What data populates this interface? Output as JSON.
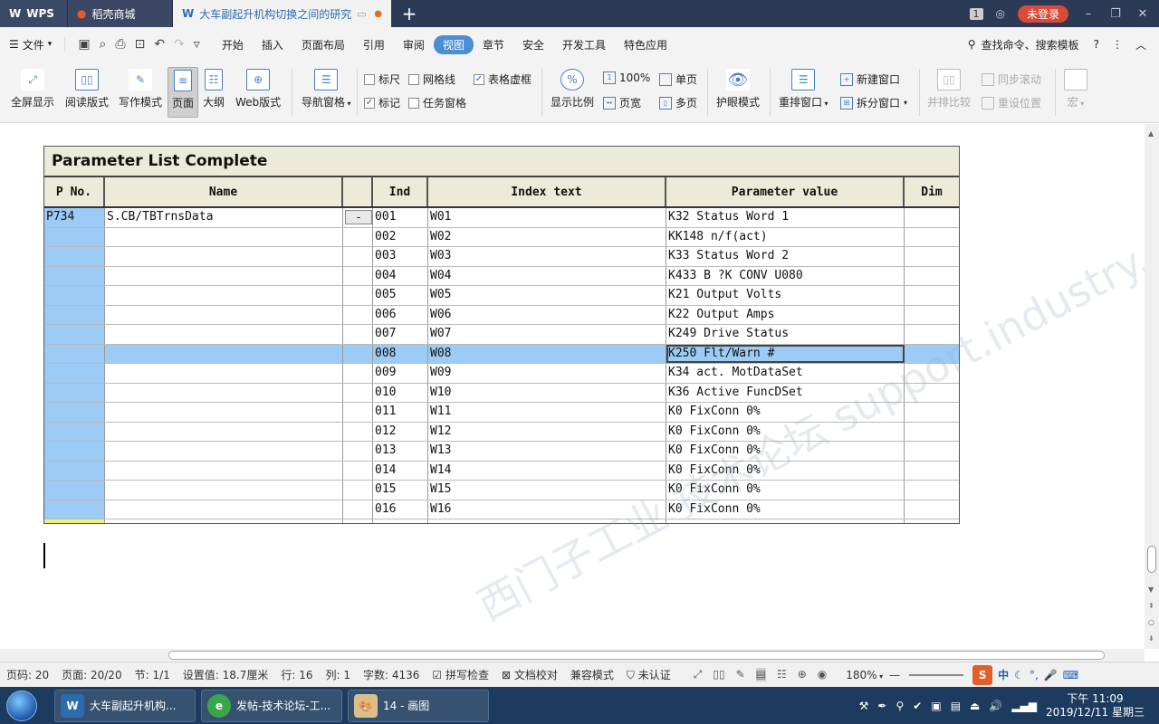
{
  "titlebar": {
    "tabs": [
      {
        "label": "WPS"
      },
      {
        "label": "稻壳商城"
      },
      {
        "label": "大车副起升机构切换之间的研究"
      }
    ],
    "page_badge": "1",
    "login_label": "未登录"
  },
  "menubar": {
    "file_label": "文件",
    "items": [
      "开始",
      "插入",
      "页面布局",
      "引用",
      "审阅",
      "视图",
      "章节",
      "安全",
      "开发工具",
      "特色应用"
    ],
    "active": "视图",
    "search_label": "查找命令、搜索模板"
  },
  "ribbon": {
    "fullscreen": "全屏显示",
    "read_mode": "阅读版式",
    "write_mode": "写作模式",
    "page": "页面",
    "outline": "大纲",
    "web": "Web版式",
    "nav_pane": "导航窗格",
    "ruler": "标尺",
    "gridlines": "网格线",
    "table_border": "表格虚框",
    "marks": "标记",
    "task_pane": "任务窗格",
    "zoom_ratio": "显示比例",
    "zoom_100": "100%",
    "single_page": "单页",
    "page_width": "页宽",
    "multi_page": "多页",
    "eye_mode": "护眼模式",
    "arrange_window": "重排窗口",
    "new_window": "新建窗口",
    "split_window": "拆分窗口",
    "side_by_side": "并排比较",
    "sync_scroll": "同步滚动",
    "reset_position": "重设位置",
    "macro": "宏"
  },
  "document": {
    "table_title": "Parameter List Complete",
    "headers": [
      "P No.",
      "Name",
      "",
      "Ind",
      "Index text",
      "Parameter value",
      "Dim"
    ],
    "p_no": "P734",
    "name": "S.CB/TBTrnsData",
    "button_label": "-",
    "rows": [
      {
        "ind": "001",
        "text": "W01",
        "value": "K32  Status Word 1"
      },
      {
        "ind": "002",
        "text": "W02",
        "value": "KK148  n/f(act)"
      },
      {
        "ind": "003",
        "text": "W03",
        "value": "K33  Status Word 2"
      },
      {
        "ind": "004",
        "text": "W04",
        "value": "K433  B ?K CONV U080"
      },
      {
        "ind": "005",
        "text": "W05",
        "value": "K21  Output Volts"
      },
      {
        "ind": "006",
        "text": "W06",
        "value": "K22  Output Amps"
      },
      {
        "ind": "007",
        "text": "W07",
        "value": "K249  Drive Status"
      },
      {
        "ind": "008",
        "text": "W08",
        "value": "K250  Flt/Warn #"
      },
      {
        "ind": "009",
        "text": "W09",
        "value": "K34  act. MotDataSet"
      },
      {
        "ind": "010",
        "text": "W10",
        "value": "K36  Active FuncDSet"
      },
      {
        "ind": "011",
        "text": "W11",
        "value": "K0  FixConn 0%"
      },
      {
        "ind": "012",
        "text": "W12",
        "value": "K0  FixConn 0%"
      },
      {
        "ind": "013",
        "text": "W13",
        "value": "K0  FixConn 0%"
      },
      {
        "ind": "014",
        "text": "W14",
        "value": "K0  FixConn 0%"
      },
      {
        "ind": "015",
        "text": "W15",
        "value": "K0  FixConn 0%"
      },
      {
        "ind": "016",
        "text": "W16",
        "value": "K0  FixConn 0%"
      }
    ],
    "watermark": "西门子工业 技术论坛 support.industry.siemens"
  },
  "statusbar": {
    "page_num": "页码: 20",
    "pages": "页面: 20/20",
    "section": "节: 1/1",
    "setting": "设置值: 18.7厘米",
    "row": "行: 16",
    "col": "列: 1",
    "word_count": "字数: 4136",
    "spell_check": "拼写检查",
    "doc_proof": "文档校对",
    "compat_mode": "兼容模式",
    "not_certified": "未认证",
    "zoom": "180%",
    "ime_lang": "中"
  },
  "taskbar": {
    "tasks": [
      {
        "label": "大车副起升机构..."
      },
      {
        "label": "发帖-技术论坛-工..."
      },
      {
        "label": "14 - 画图"
      }
    ],
    "time": "下午 11:09",
    "date": "2019/12/11 星期三"
  }
}
